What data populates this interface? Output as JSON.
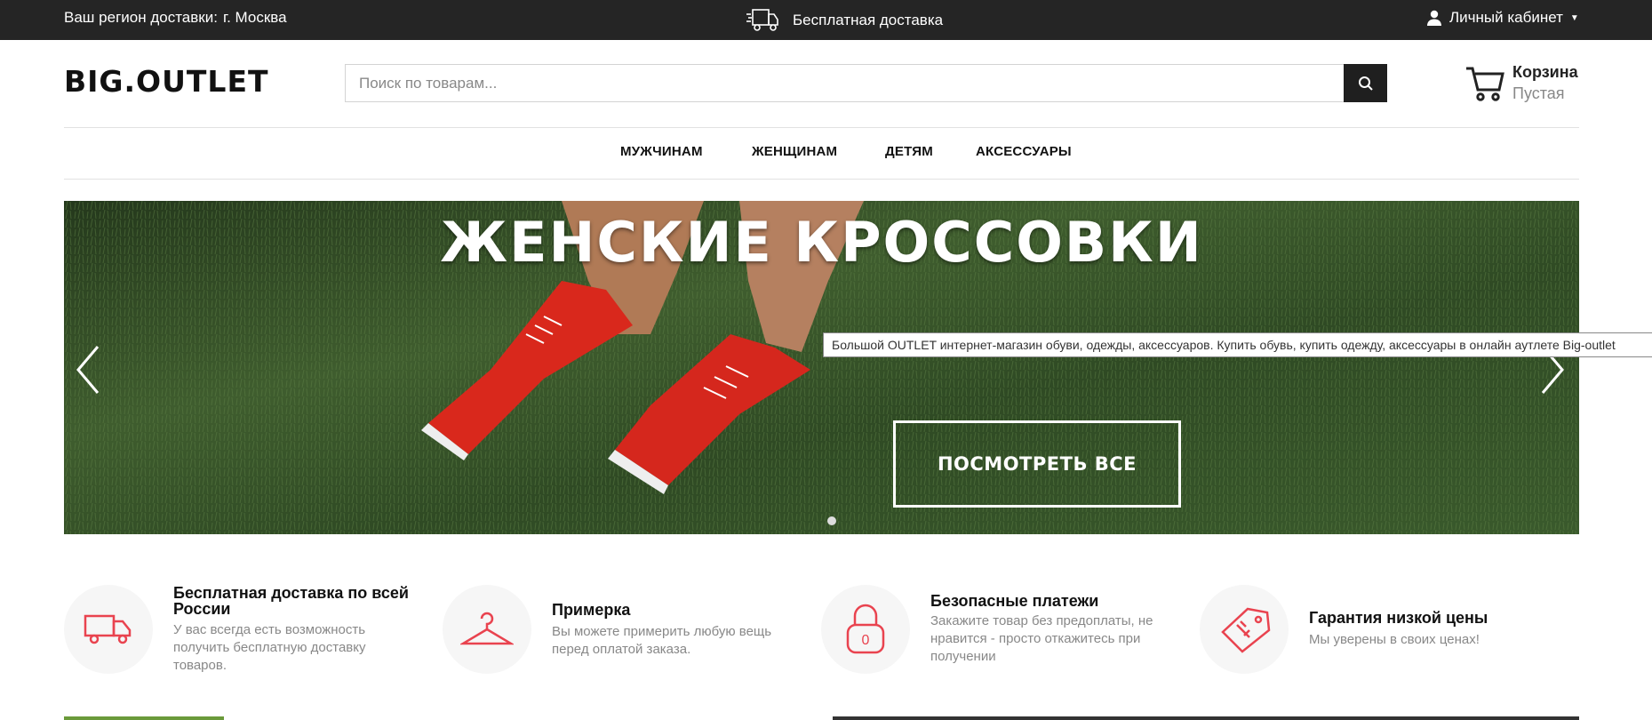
{
  "topbar": {
    "region_label": "Ваш регион доставки:",
    "region_city": "г. Москва",
    "free_shipping": "Бесплатная доставка",
    "account": "Личный кабинет"
  },
  "header": {
    "logo": "BIG.OUTLET",
    "search_placeholder": "Поиск по товарам...",
    "cart_title": "Корзина",
    "cart_status": "Пустая"
  },
  "nav": {
    "items": [
      "МУЖЧИНАМ",
      "ЖЕНЩИНАМ",
      "ДЕТЯМ",
      "АКСЕССУАРЫ"
    ]
  },
  "banner": {
    "headline": "ЖЕНСКИЕ КРОССОВКИ",
    "cta": "ПОСМОТРЕТЬ ВСЕ"
  },
  "tooltip": "Большой OUTLET интернет-магазин обуви, одежды, аксессуаров. Купить обувь, купить одежду, аксессуары в онлайн аутлете Big-outlet",
  "features": [
    {
      "title": "Бесплатная доставка по всей России",
      "desc": "У вас всегда есть возможность получить бесплатную доставку товаров.",
      "icon": "truck-icon"
    },
    {
      "title": "Примерка",
      "desc": "Вы можете примерить любую вещь перед оплатой заказа.",
      "icon": "hanger-icon"
    },
    {
      "title": "Безопасные платежи",
      "desc": "Закажите товар без предоплаты, не нравится - просто откажитесь при получении",
      "icon": "padlock-icon"
    },
    {
      "title": "Гарантия низкой цены",
      "desc": "Мы уверены в своих ценах!",
      "icon": "price-tag-icon"
    }
  ],
  "colors": {
    "topbar_bg": "#252525",
    "accent_red": "#e9434f",
    "search_button": "#1f1f1f"
  }
}
